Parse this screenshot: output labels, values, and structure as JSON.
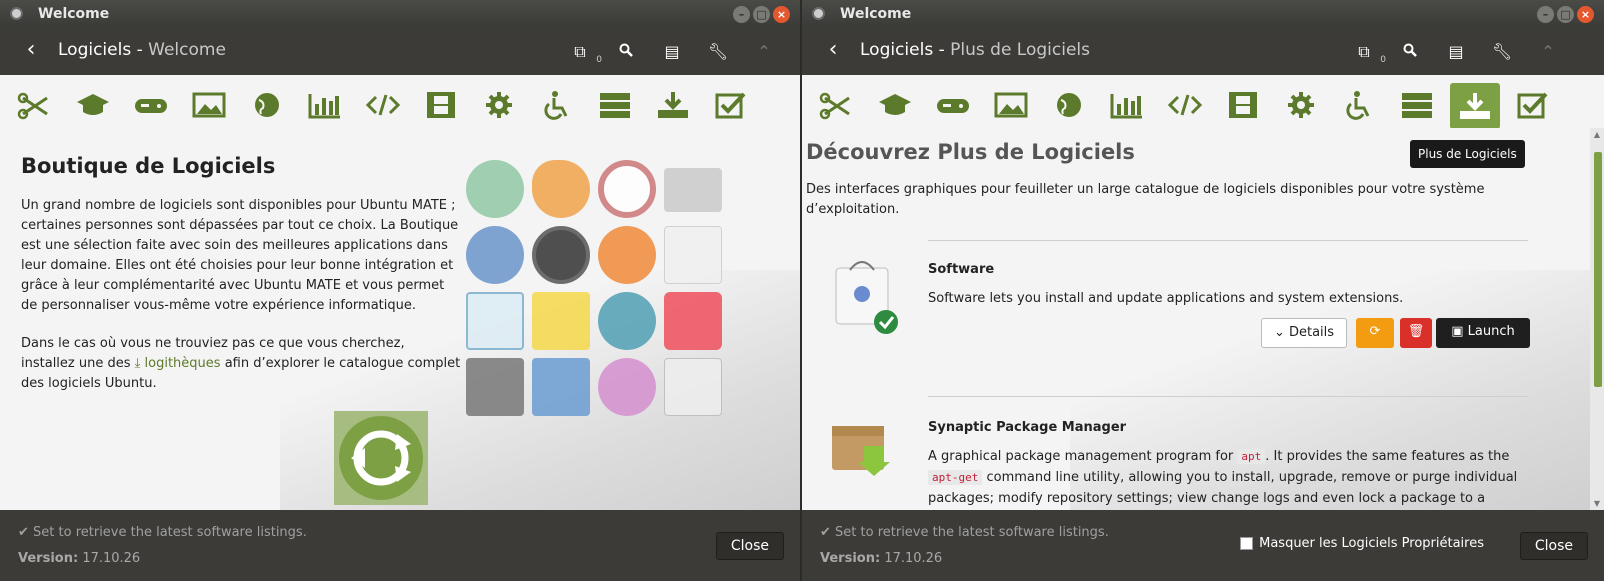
{
  "left": {
    "window_title": "Welcome",
    "header": {
      "title": "Logiciels - ",
      "subtitle": "Welcome",
      "queue_count": "0"
    },
    "content": {
      "heading": "Boutique de Logiciels",
      "para1": "Un grand nombre de logiciels sont disponibles pour Ubuntu MATE ; certaines personnes sont dépassées par tout ce choix. La Boutique est une sélection faite avec soin des meilleures applications dans leur domaine. Elles ont été choisies pour leur bonne intégration et grâce à leur complémentarité avec Ubuntu MATE et vous permet de personnaliser vous-même votre expérience informatique.",
      "para2_a": "Dans le cas où vous ne trouviez pas ce que vous cherchez, installez une des ",
      "para2_link": "logithèques",
      "para2_b": " afin d’explorer le catalogue complet des logiciels Ubuntu."
    },
    "footer": {
      "status": "Set to retrieve the latest software listings.",
      "version_label": "Version:",
      "version": "17.10.26",
      "close": "Close"
    }
  },
  "right": {
    "window_title": "Welcome",
    "header": {
      "title": "Logiciels - ",
      "subtitle": "Plus de Logiciels",
      "queue_count": "0"
    },
    "tooltip": "Plus de Logiciels",
    "content": {
      "heading": "Découvrez Plus de Logiciels",
      "intro": "Des interfaces graphiques pour feuilleter un large catalogue de logiciels disponibles pour votre système d’exploitation.",
      "items": [
        {
          "title": "Software",
          "desc": "Software lets you install and update applications and system extensions.",
          "details": "Details",
          "launch": "Launch"
        },
        {
          "title": "Synaptic Package Manager",
          "desc_a": "A graphical package management program for ",
          "code1": "apt",
          "desc_b": ". It provides the same features as the ",
          "code2": "apt-get",
          "desc_c": " command line utility, allowing you to install, upgrade, remove or purge individual packages; modify repository settings; view change logs and even lock a package to a specific version."
        }
      ]
    },
    "footer": {
      "status": "Set to retrieve the latest software listings.",
      "version_label": "Version:",
      "version": "17.10.26",
      "hide_proprietary": "Masquer les Logiciels Propriétaires",
      "close": "Close"
    }
  },
  "categories": [
    "accessories",
    "education",
    "games",
    "graphics",
    "internet",
    "office",
    "programming",
    "sound-video",
    "system-tools",
    "universal-access",
    "servers",
    "more-software",
    "fixes"
  ],
  "colors": {
    "accent": "#7ea045",
    "header": "#3c3b37",
    "close_red": "#e3582f",
    "reinstall_orange": "#f39c12",
    "remove_red": "#d9302a"
  }
}
